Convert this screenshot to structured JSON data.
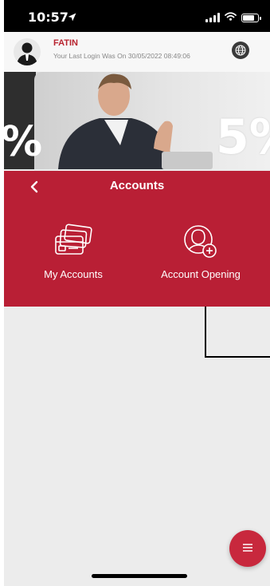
{
  "status_bar": {
    "time": "10:57"
  },
  "header": {
    "username": "FATIN",
    "last_login": "Your Last Login Was On 30/05/2022 08:49:06"
  },
  "banner": {
    "text_left": "%",
    "text_right": "5%"
  },
  "accounts_panel": {
    "title": "Accounts",
    "items": [
      {
        "label": "My Accounts",
        "icon": "cards-icon"
      },
      {
        "label": "Account Opening",
        "icon": "user-add-icon"
      }
    ]
  },
  "colors": {
    "accent": "#b91f35",
    "fab": "#c8283d",
    "header_name": "#b8232f"
  }
}
